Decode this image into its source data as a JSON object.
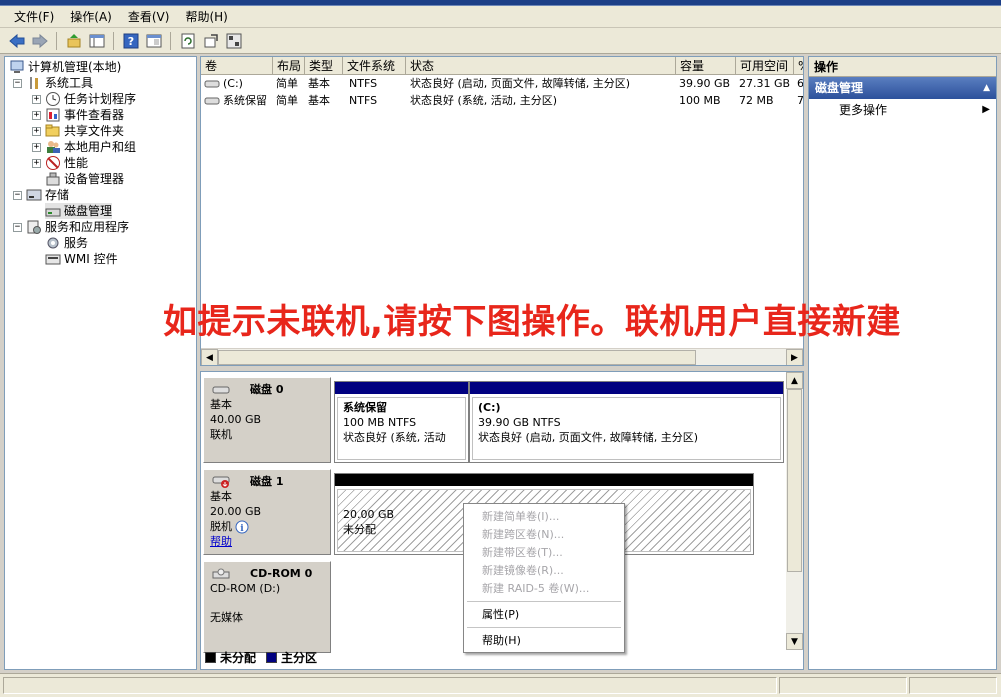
{
  "menu": [
    "文件(F)",
    "操作(A)",
    "查看(V)",
    "帮助(H)"
  ],
  "toolbar": {
    "icons": [
      "back-icon",
      "forward-icon",
      "up-icon",
      "show-tree-icon",
      "help-icon",
      "properties-icon",
      "refresh-icon",
      "export-icon",
      "settings-icon"
    ]
  },
  "tree": {
    "root": "计算机管理(本地)",
    "system_tools": "系统工具",
    "task_scheduler": "任务计划程序",
    "event_viewer": "事件查看器",
    "shared_folders": "共享文件夹",
    "local_users": "本地用户和组",
    "performance": "性能",
    "device_manager": "设备管理器",
    "storage": "存储",
    "disk_mgmt": "磁盘管理",
    "services_apps": "服务和应用程序",
    "services": "服务",
    "wmi": "WMI 控件"
  },
  "volume_list": {
    "headers": [
      "卷",
      "布局",
      "类型",
      "文件系统",
      "状态",
      "容量",
      "可用空间",
      "%"
    ],
    "rows": [
      {
        "name": "(C:)",
        "layout": "简单",
        "type": "基本",
        "fs": "NTFS",
        "status": "状态良好 (启动, 页面文件, 故障转储, 主分区)",
        "capacity": "39.90 GB",
        "free": "27.31 GB",
        "pct": "6"
      },
      {
        "name": "系统保留",
        "layout": "简单",
        "type": "基本",
        "fs": "NTFS",
        "status": "状态良好 (系统, 活动, 主分区)",
        "capacity": "100 MB",
        "free": "72 MB",
        "pct": "7"
      }
    ]
  },
  "disks": {
    "disk0": {
      "name": "磁盘 0",
      "kind": "基本",
      "size": "40.00 GB",
      "state": "联机"
    },
    "disk0_p1": {
      "title": "系统保留",
      "size": "100 MB NTFS",
      "status": "状态良好 (系统, 活动"
    },
    "disk0_p2": {
      "title": "(C:)",
      "size": "39.90 GB NTFS",
      "status": "状态良好 (启动, 页面文件, 故障转储, 主分区)"
    },
    "disk1": {
      "name": "磁盘 1",
      "kind": "基本",
      "size": "20.00 GB",
      "state": "脱机",
      "help": "帮助"
    },
    "disk1_p1": {
      "size": "20.00 GB",
      "status": "未分配"
    },
    "cdrom": {
      "name": "CD-ROM 0",
      "kind": "CD-ROM (D:)",
      "state": "无媒体"
    }
  },
  "legend": {
    "unallocated": "未分配",
    "primary": "主分区"
  },
  "colors": {
    "unallocated": "#000000",
    "primary": "#000080",
    "overlay_text": "#e8261b",
    "action_header": "#2c519b"
  },
  "actions": {
    "header": "操作",
    "section": "磁盘管理",
    "more": "更多操作"
  },
  "context_menu": {
    "items_disabled": [
      "新建简单卷(I)...",
      "新建跨区卷(N)...",
      "新建带区卷(T)...",
      "新建镜像卷(R)...",
      "新建 RAID-5 卷(W)..."
    ],
    "properties": "属性(P)",
    "help": "帮助(H)"
  },
  "overlay_text": "如提示未联机,请按下图操作。联机用户直接新建"
}
